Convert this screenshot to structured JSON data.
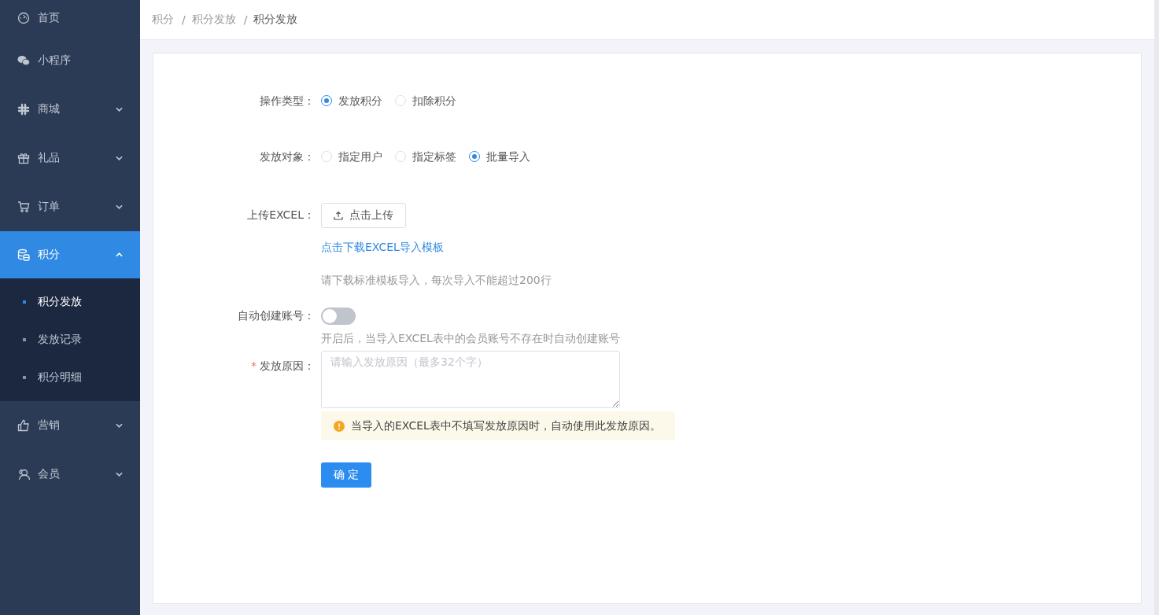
{
  "sidebar": {
    "items": [
      {
        "label": "首页",
        "selected": false
      },
      {
        "label": "小程序",
        "selected": false
      },
      {
        "label": "商城",
        "selected": false,
        "expanded": false
      },
      {
        "label": "礼品",
        "selected": false,
        "expanded": false
      },
      {
        "label": "订单",
        "selected": false,
        "expanded": false
      },
      {
        "label": "积分",
        "selected": true,
        "expanded": true,
        "children": [
          {
            "label": "积分发放",
            "selected": true
          },
          {
            "label": "发放记录",
            "selected": false
          },
          {
            "label": "积分明细",
            "selected": false
          }
        ]
      },
      {
        "label": "营销",
        "selected": false,
        "expanded": false
      },
      {
        "label": "会员",
        "selected": false,
        "expanded": false
      }
    ]
  },
  "breadcrumb": [
    {
      "label": "积分"
    },
    {
      "separator": "/",
      "label": "积分发放"
    },
    {
      "separator": "/",
      "label": "积分发放"
    }
  ],
  "form": {
    "operation_type": {
      "label": "操作类型：",
      "options": [
        {
          "label": "发放积分",
          "selected": true
        },
        {
          "label": "扣除积分",
          "selected": false
        }
      ]
    },
    "target": {
      "label": "发放对象：",
      "options": [
        {
          "label": "指定用户",
          "selected": false
        },
        {
          "label": "指定标签",
          "selected": false
        },
        {
          "label": "批量导入",
          "selected": true
        }
      ]
    },
    "upload": {
      "label": "上传EXCEL：",
      "button": "点击上传",
      "template_link": "点击下载EXCEL导入模板",
      "hint": "请下载标准模板导入，每次导入不能超过200行"
    },
    "auto_create": {
      "label": "自动创建账号：",
      "on": false,
      "hint": "开启后，当导入EXCEL表中的会员账号不存在时自动创建账号"
    },
    "reason": {
      "label": "发放原因：",
      "required": true,
      "required_mark": "*",
      "placeholder": "请输入发放原因（最多32个字）",
      "notice": "当导入的EXCEL表中不填写发放原因时，自动使用此发放原因。"
    },
    "submit": "确 定"
  }
}
